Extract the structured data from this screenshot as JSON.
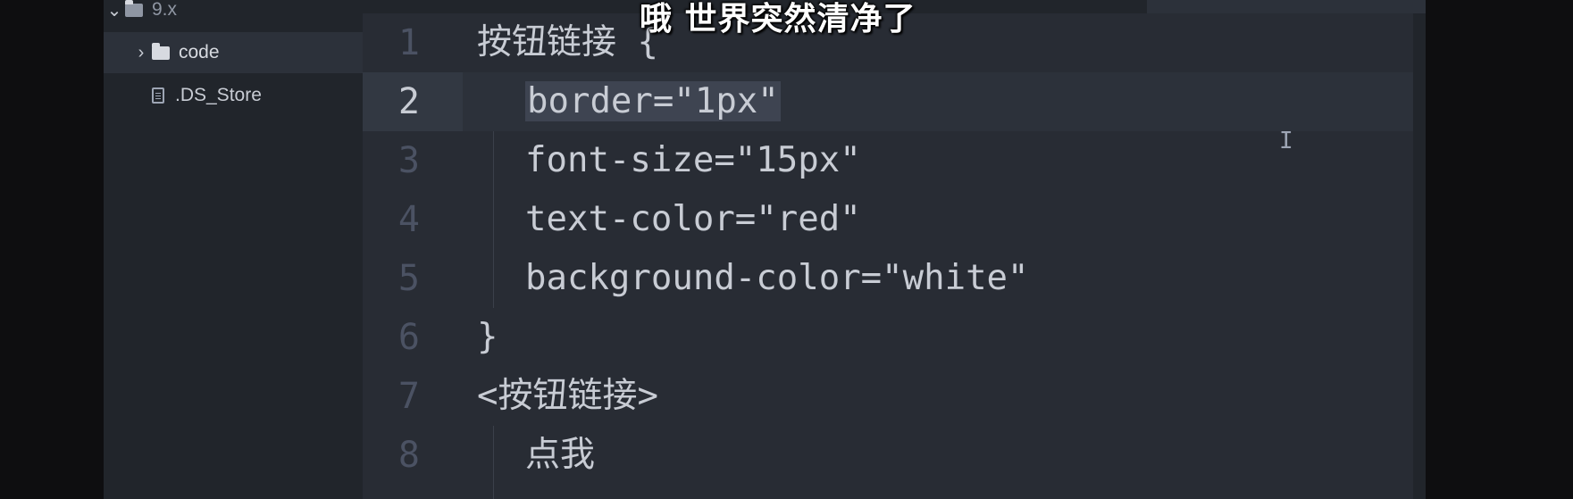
{
  "sidebar": {
    "root": {
      "label": "9.x"
    },
    "items": [
      {
        "label": "code",
        "type": "folder"
      },
      {
        "label": ".DS_Store",
        "type": "file"
      }
    ]
  },
  "editor": {
    "lines": [
      {
        "num": "1",
        "text": "按钮链接 {"
      },
      {
        "num": "2",
        "text": "border=\"1px\""
      },
      {
        "num": "3",
        "text": "font-size=\"15px\""
      },
      {
        "num": "4",
        "text": "text-color=\"red\""
      },
      {
        "num": "5",
        "text": "background-color=\"white\""
      },
      {
        "num": "6",
        "text": "}"
      },
      {
        "num": "7",
        "text": "<按钮链接>"
      },
      {
        "num": "8",
        "text": "点我"
      }
    ],
    "active_line": "2"
  },
  "subtitle": "哦 世界突然清净了",
  "icons": [
    "chevron-down-icon",
    "folder-icon",
    "chevron-right-icon",
    "file-icon",
    "text-cursor-icon"
  ],
  "colors": {
    "sidebar_bg": "#21252b",
    "editor_bg": "#282c34",
    "active_line": "#2c313a",
    "selection": "#3e4451",
    "text": "#c8ccd4"
  }
}
